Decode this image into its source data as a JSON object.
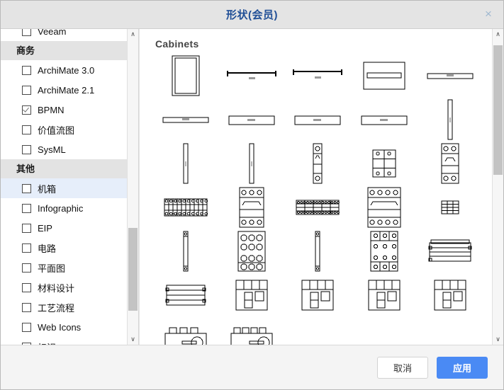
{
  "window": {
    "title": "形状(会员)",
    "close_label": "×"
  },
  "sidebar": {
    "clipped_top_item": {
      "label": "Veeam",
      "checked": false
    },
    "groups": [
      {
        "header": "商务",
        "items": [
          {
            "label": "ArchiMate 3.0",
            "checked": false,
            "selected": false
          },
          {
            "label": "ArchiMate 2.1",
            "checked": false,
            "selected": false
          },
          {
            "label": "BPMN",
            "checked": true,
            "selected": false
          },
          {
            "label": "价值流图",
            "checked": false,
            "selected": false
          },
          {
            "label": "SysML",
            "checked": false,
            "selected": false
          }
        ]
      },
      {
        "header": "其他",
        "items": [
          {
            "label": "机箱",
            "checked": false,
            "selected": true
          },
          {
            "label": "Infographic",
            "checked": false,
            "selected": false
          },
          {
            "label": "EIP",
            "checked": false,
            "selected": false
          },
          {
            "label": "电路",
            "checked": false,
            "selected": false
          },
          {
            "label": "平面图",
            "checked": false,
            "selected": false
          },
          {
            "label": "材料设计",
            "checked": false,
            "selected": false
          },
          {
            "label": "工艺流程",
            "checked": false,
            "selected": false
          },
          {
            "label": "Web Icons",
            "checked": false,
            "selected": false
          },
          {
            "label": "标识",
            "checked": false,
            "selected": false
          }
        ]
      }
    ],
    "scrollbar": {
      "up_arrow": "∧",
      "down_arrow": "∨",
      "thumb_top_pct": 64,
      "thumb_height_pct": 28
    }
  },
  "shapes_panel": {
    "section_title": "Cabinets",
    "scrollbar": {
      "up_arrow": "∧",
      "down_arrow": "∨",
      "thumb_top_pct": 2,
      "thumb_height_pct": 44
    },
    "shapes": [
      {
        "name": "rack-cabinet-front",
        "kind": "cabinet-tall"
      },
      {
        "name": "rack-unit-dimension-left",
        "kind": "dim-line"
      },
      {
        "name": "rack-unit-dimension-right",
        "kind": "dim-line-2"
      },
      {
        "name": "rack-shelf-wide",
        "kind": "shelf-box"
      },
      {
        "name": "rack-plate-thin-1",
        "kind": "plate-thin"
      },
      {
        "name": "rack-plate-thin-2",
        "kind": "plate-thin"
      },
      {
        "name": "rack-panel-1",
        "kind": "panel-flat"
      },
      {
        "name": "rack-panel-2",
        "kind": "panel-flat"
      },
      {
        "name": "rack-panel-3",
        "kind": "panel-flat"
      },
      {
        "name": "rail-vertical-1",
        "kind": "rail"
      },
      {
        "name": "rail-vertical-2",
        "kind": "rail"
      },
      {
        "name": "rail-vertical-3",
        "kind": "rail"
      },
      {
        "name": "breaker-1p",
        "kind": "breaker-1p"
      },
      {
        "name": "terminal-block-wide",
        "kind": "terminal-grid"
      },
      {
        "name": "breaker-2p",
        "kind": "breaker-2p"
      },
      {
        "name": "terminal-block-long",
        "kind": "terminal-grid-long"
      },
      {
        "name": "breaker-3p",
        "kind": "breaker-3p"
      },
      {
        "name": "terminal-strip-5",
        "kind": "terminal-strip"
      },
      {
        "name": "breaker-4p",
        "kind": "breaker-4p"
      },
      {
        "name": "terminal-strip-narrow",
        "kind": "terminal-strip-narrow"
      },
      {
        "name": "din-rail-short",
        "kind": "din-rail"
      },
      {
        "name": "contactor-6-hole",
        "kind": "contactor-holes"
      },
      {
        "name": "din-rail-long",
        "kind": "din-rail"
      },
      {
        "name": "contactor-9-hole",
        "kind": "contactor-holes-9"
      },
      {
        "name": "cable-tray-1",
        "kind": "cable-tray"
      },
      {
        "name": "cable-tray-2",
        "kind": "cable-tray-2"
      },
      {
        "name": "switchgear-1",
        "kind": "switchgear"
      },
      {
        "name": "switchgear-2",
        "kind": "switchgear"
      },
      {
        "name": "switchgear-3",
        "kind": "switchgear"
      },
      {
        "name": "switchgear-4",
        "kind": "switchgear"
      },
      {
        "name": "rotary-switch-1",
        "kind": "rotary"
      },
      {
        "name": "rotary-switch-2",
        "kind": "rotary-4"
      }
    ]
  },
  "footer": {
    "cancel_label": "取消",
    "apply_label": "应用",
    "apply_color": "#4a8af4"
  }
}
